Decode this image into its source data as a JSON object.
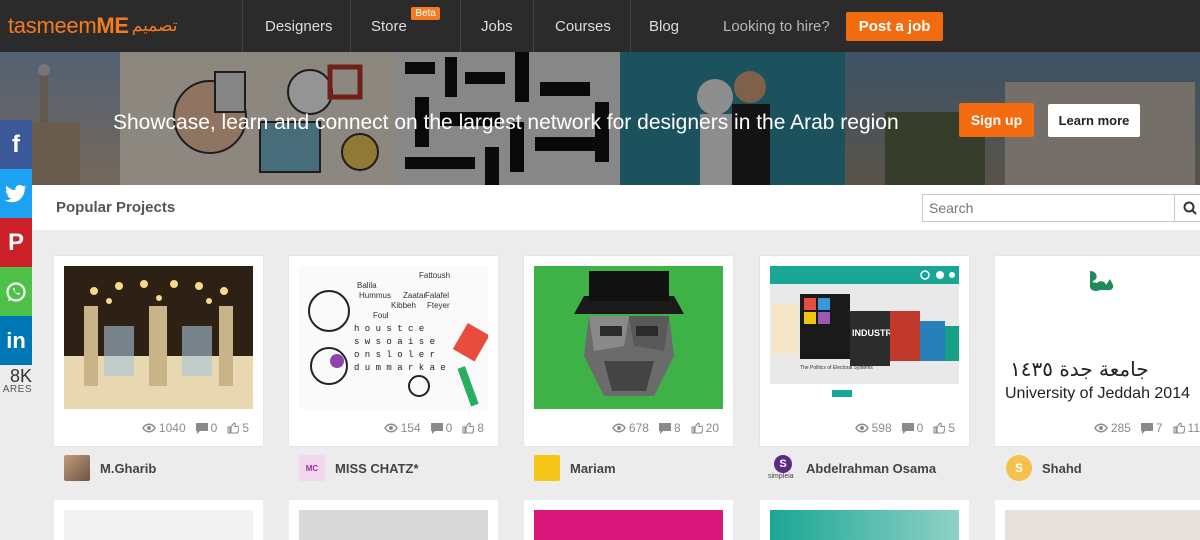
{
  "nav": {
    "logo_text": "tasmeemME",
    "logo_arabic": "تصميم",
    "items": [
      {
        "label": "Designers"
      },
      {
        "label": "Store",
        "badge": "Beta"
      },
      {
        "label": "Jobs"
      },
      {
        "label": "Courses"
      },
      {
        "label": "Blog"
      }
    ],
    "hire_text": "Looking to hire?",
    "post_job": "Post a job"
  },
  "hero": {
    "tagline": "Showcase, learn and connect on the largest network for designers in the Arab region",
    "signup": "Sign up",
    "learn_more": "Learn more"
  },
  "section": {
    "title": "Popular Projects",
    "search_placeholder": "Search"
  },
  "share": {
    "count": "8K",
    "label": "ARES",
    "networks": [
      "facebook-icon",
      "twitter-icon",
      "pinterest-icon",
      "whatsapp-icon",
      "linkedin-icon"
    ]
  },
  "projects": [
    {
      "author": "M.Gharib",
      "views": "1040",
      "comments": "0",
      "likes": "5"
    },
    {
      "author": "MISS CHATZ*",
      "views": "154",
      "comments": "0",
      "likes": "8"
    },
    {
      "author": "Mariam",
      "views": "678",
      "comments": "8",
      "likes": "20"
    },
    {
      "author": "Abdelrahman Osama",
      "views": "598",
      "comments": "0",
      "likes": "5"
    },
    {
      "author": "Shahd",
      "views": "285",
      "comments": "7",
      "likes": "11"
    }
  ],
  "thumb_texts": {
    "jeddah_arabic": "جامعة جدة ١٤٣٥",
    "jeddah_english": "University of Jeddah 2014",
    "puzzle_words": [
      "Fattoush",
      "Balila",
      "Hummus",
      "Falafel",
      "Zaatar",
      "Kibbeh",
      "Foul",
      "Fteyer"
    ],
    "book_title": "The Politics of Electoral Systems",
    "book_industry": "INDUSTRY",
    "simpleia": "simpleia"
  },
  "colors": {
    "brand": "#f47b20",
    "nav_bg": "#2b2b2b",
    "cta": "#f26b0f"
  }
}
